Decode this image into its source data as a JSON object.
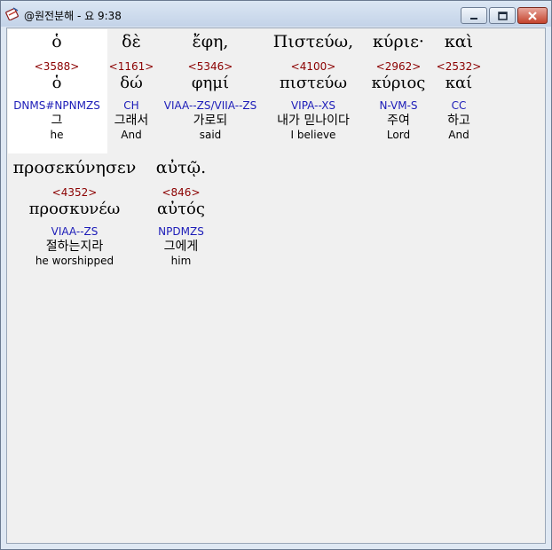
{
  "window": {
    "title": "@원전분해 - 요 9:38",
    "icons": {
      "app": "bible-app-icon",
      "minimize": "minimize-icon",
      "maximize": "maximize-icon",
      "close": "close-icon"
    }
  },
  "words": [
    {
      "greek": "ὁ",
      "strong": "<3588>",
      "lemma": "ὁ",
      "morph": "DNMS#NPNMZS",
      "korean": "그",
      "english": "he"
    },
    {
      "greek": "δὲ",
      "strong": "<1161>",
      "lemma": "δώ",
      "morph": "CH",
      "korean": "그래서",
      "english": "And"
    },
    {
      "greek": "ἔφη,",
      "strong": "<5346>",
      "lemma": "φημί",
      "morph": "VIAA--ZS/VIIA--ZS",
      "korean": "가로되",
      "english": "said"
    },
    {
      "greek": "Πιστεύω,",
      "strong": "<4100>",
      "lemma": "πιστεύω",
      "morph": "VIPA--XS",
      "korean": "내가 믿나이다",
      "english": "I believe"
    },
    {
      "greek": "κύριε·",
      "strong": "<2962>",
      "lemma": "κύριος",
      "morph": "N-VM-S",
      "korean": "주여",
      "english": "Lord"
    },
    {
      "greek": "καὶ",
      "strong": "<2532>",
      "lemma": "καί",
      "morph": "CC",
      "korean": "하고",
      "english": "And"
    },
    {
      "greek": "προσεκύνησεν",
      "strong": "<4352>",
      "lemma": "προσκυνέω",
      "morph": "VIAA--ZS",
      "korean": "절하는지라",
      "english": "he worshipped"
    },
    {
      "greek": "αὐτῷ.",
      "strong": "<846>",
      "lemma": "αὐτός",
      "morph": "NPDMZS",
      "korean": "그에게",
      "english": "him"
    }
  ]
}
